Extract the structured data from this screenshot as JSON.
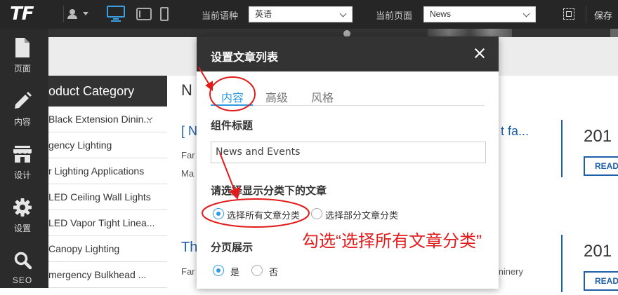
{
  "topbar": {
    "logo": "TF",
    "language_label": "当前语种",
    "language_value": "英语",
    "page_label": "当前页面",
    "page_value": "News",
    "save_label": "保存"
  },
  "sidebar": {
    "items": [
      {
        "label": "页面",
        "icon": "page-icon"
      },
      {
        "label": "内容",
        "icon": "pencil-icon"
      },
      {
        "label": "设计",
        "icon": "store-icon"
      },
      {
        "label": "设置",
        "icon": "gear-icon"
      },
      {
        "label": "SEO",
        "icon": "search-icon"
      }
    ]
  },
  "background": {
    "category_title": "oduct Category",
    "categories": [
      "Black Extension Dinin...",
      "gency Lighting",
      "r Lighting Applications",
      "LED Ceiling Wall Lights",
      "LED Vapor Tight Linea...",
      "Canopy Lighting",
      "mergency Bulkhead ..."
    ],
    "heading_fragment": "N",
    "link1_start": "[ N",
    "link1_end": "t fa...",
    "frag_fa1": "Far",
    "frag_ma": "Ma",
    "link2_start": "Th",
    "frag_fa2": "Far",
    "frag_minery": "minery",
    "year": "201",
    "read": "READ"
  },
  "modal": {
    "title": "设置文章列表",
    "tabs": [
      {
        "label": "内容",
        "active": true
      },
      {
        "label": "高级",
        "active": false
      },
      {
        "label": "风格",
        "active": false
      }
    ],
    "component_title_label": "组件标题",
    "component_title_value": "News and Events",
    "category_section_label": "请选择显示分类下的文章",
    "category_options": [
      {
        "label": "选择所有文章分类",
        "checked": true
      },
      {
        "label": "选择部分文章分类",
        "checked": false
      }
    ],
    "pagination_label": "分页展示",
    "pagination_options": [
      {
        "label": "是",
        "checked": true
      },
      {
        "label": "否",
        "checked": false
      }
    ]
  },
  "annotation": {
    "text": "勾选“选择所有文章分类”",
    "color": "#e21b1b"
  },
  "colors": {
    "accent": "#2f9ae0",
    "topbar": "#262626",
    "sidebar": "#2b2b2b",
    "link_blue": "#1e5fa8"
  }
}
